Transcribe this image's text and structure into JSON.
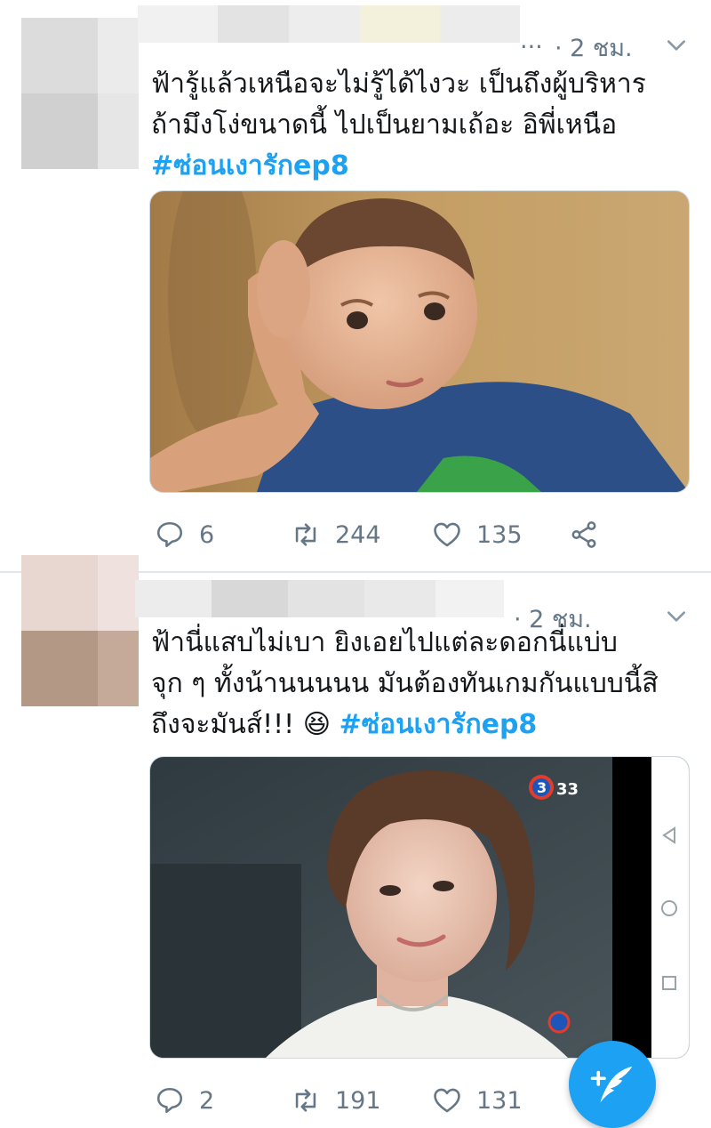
{
  "tweets": [
    {
      "time": "· 2 ชม.",
      "ellipsis": "...",
      "lines": [
        "ฟ้ารู้แล้วเหนือจะไม่รู้ได้ไงวะ เป็นถึงผู้บริหาร",
        "ถ้ามึงโง่ขนาดนี้ ไปเป็นยามเถ้อะ อิพี่เหนือ"
      ],
      "hashtag": "#ซ่อนเงารักep8",
      "replies": "6",
      "retweets": "244",
      "likes": "135"
    },
    {
      "time": "· 2 ชม.",
      "lines": [
        "ฟ้านี่แสบไม่เบา ยิงเอยไปแต่ละดอกนี่แบ่บ",
        "จุก ๆ ทั้งน้านนนนน มันต้องทันเกมกันแบบนี้สิ",
        "ถึงจะมันส์!!!"
      ],
      "emoji": "😆",
      "hashtag": "#ซ่อนเงารักep8",
      "channel_logo": "3",
      "channel_number": "33",
      "replies": "2",
      "retweets": "191",
      "likes": "131"
    }
  ],
  "icons": {
    "reply": "reply-icon",
    "retweet": "retweet-icon",
    "like": "heart-icon",
    "share": "share-icon",
    "compose": "compose-tweet-icon"
  },
  "colors": {
    "accent": "#1da1f2",
    "muted": "#657786",
    "text": "#14171a"
  }
}
